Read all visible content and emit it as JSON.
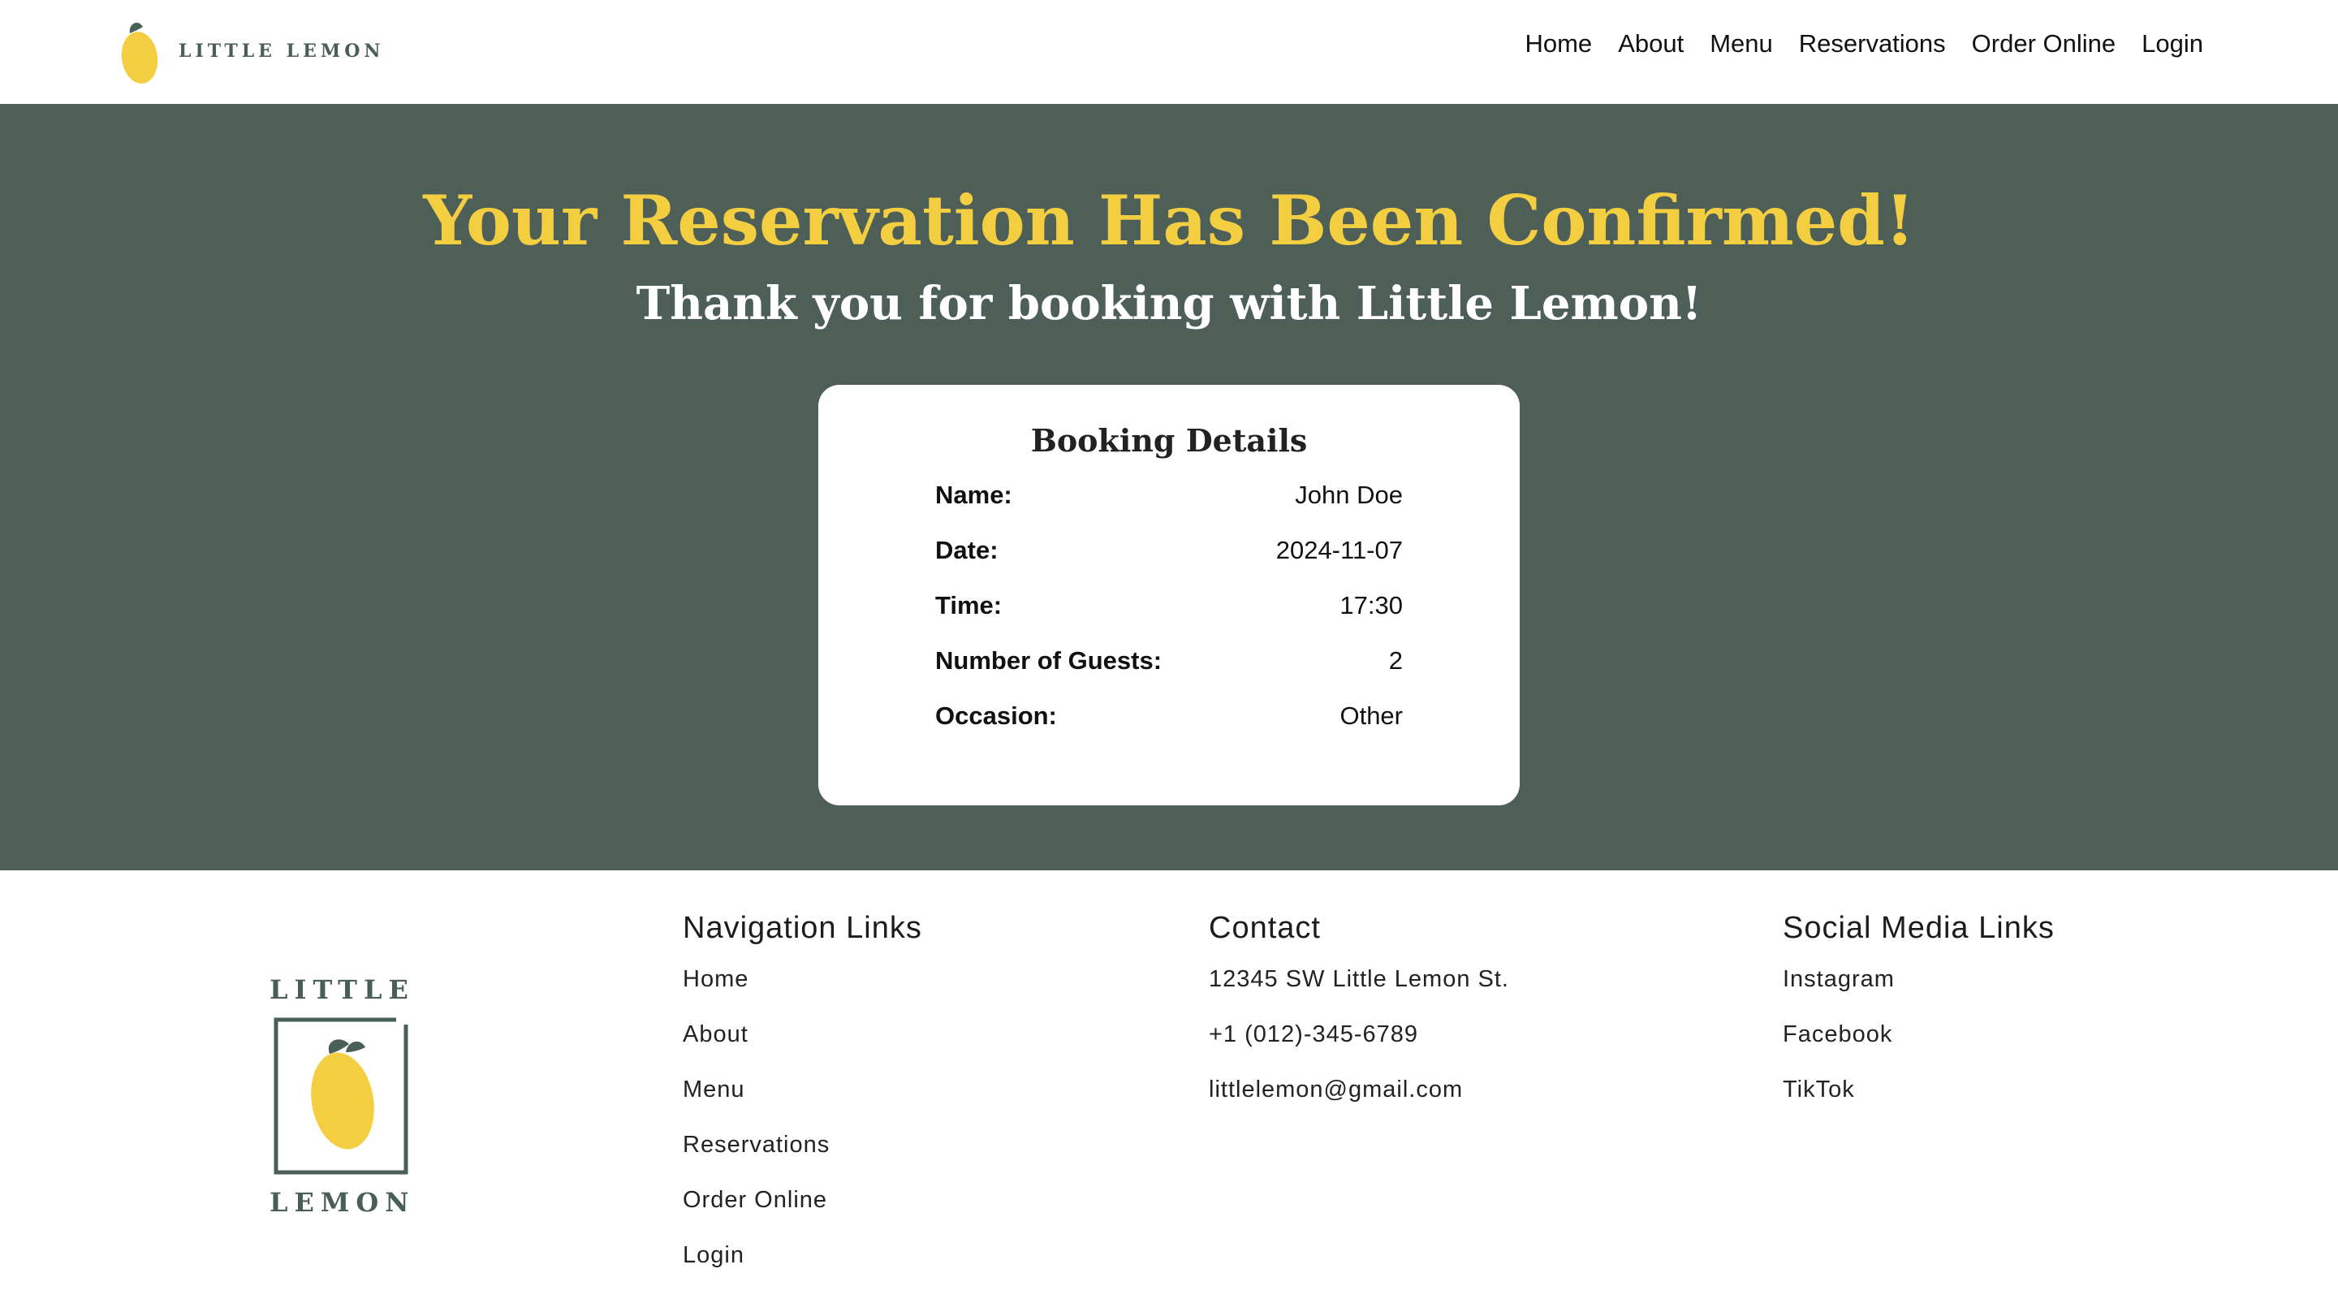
{
  "brand": {
    "name": "LITTLE LEMON"
  },
  "nav": {
    "items": [
      {
        "label": "Home"
      },
      {
        "label": "About"
      },
      {
        "label": "Menu"
      },
      {
        "label": "Reservations"
      },
      {
        "label": "Order Online"
      },
      {
        "label": "Login"
      }
    ]
  },
  "confirmation": {
    "title": "Your Reservation Has Been Confirmed!",
    "subtitle": "Thank you for booking with Little Lemon!",
    "card_title": "Booking Details",
    "details": [
      {
        "label": "Name:",
        "value": "John Doe"
      },
      {
        "label": "Date:",
        "value": "2024-11-07"
      },
      {
        "label": "Time:",
        "value": "17:30"
      },
      {
        "label": "Number of Guests:",
        "value": "2"
      },
      {
        "label": "Occasion:",
        "value": "Other"
      }
    ]
  },
  "footer": {
    "logo_top": "LITTLE",
    "logo_bottom": "LEMON",
    "navigation": {
      "heading": "Navigation Links",
      "links": [
        "Home",
        "About",
        "Menu",
        "Reservations",
        "Order Online",
        "Login"
      ]
    },
    "contact": {
      "heading": "Contact",
      "address": "12345 SW Little Lemon St.",
      "phone": "+1 (012)-345-6789",
      "email": "littlelemon@gmail.com"
    },
    "social": {
      "heading": "Social Media Links",
      "links": [
        "Instagram",
        "Facebook",
        "TikTok"
      ]
    }
  },
  "colors": {
    "brand_green": "#495e57",
    "hero_bg": "#4e5f57",
    "accent_yellow": "#f4ce41"
  }
}
